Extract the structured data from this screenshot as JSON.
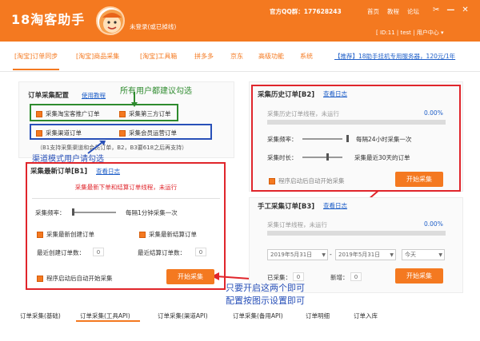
{
  "header": {
    "app_title": "18淘客助手",
    "login_status": "未登录(或已掉线)",
    "qq_group": "官方QQ群：177628243",
    "links": [
      "首页",
      "教程",
      "论坛"
    ],
    "user_bar": "[ ID:11 | test | 用户中心 ▾"
  },
  "nav": {
    "items": [
      "[淘宝]订单同步",
      "[淘宝]商品采集",
      "[淘宝]工具箱",
      "拼多多",
      "京东",
      "高级功能",
      "系统"
    ],
    "promo": "【推荐】18助手挂机专用服务器，120元/1年"
  },
  "config": {
    "title": "订单采集配置",
    "help": "使用教程",
    "options": [
      "采集淘宝客推广订单",
      "采集第三方订单",
      "采集渠道订单",
      "采集会员运营订单"
    ],
    "hint": "（B1支持采集渠道和会员订单，B2，B3要618之后再支持）",
    "note_green": "所有用户都建议勾选",
    "note_blue": "渠道模式用户请勾选"
  },
  "b1": {
    "title": "采集最新订单[B1]",
    "log": "查看日志",
    "status": "采集最新下单和结算订单线程，未运行",
    "freq_label": "采集频率：",
    "freq_value": "每隔1分钟采集一次",
    "opt_new": "采集最新创建订单",
    "opt_settle": "采集最新结算订单",
    "count_new_label": "最近创建订单数：",
    "count_new": "0",
    "count_settle_label": "最近结算订单数：",
    "count_settle": "0",
    "auto_start": "程序启动后自动开始采集",
    "start": "开始采集"
  },
  "b2": {
    "title": "采集历史订单[B2]",
    "log": "查看日志",
    "status": "采集历史订单线程，未运行",
    "freq_label": "采集频率：",
    "freq_value": "每隔24小时采集一次",
    "time_label": "采集时长：",
    "time_value": "采集最近30天的订单",
    "auto_start": "程序启动后自动开始采集",
    "start": "开始采集"
  },
  "b3": {
    "title": "手工采集订单[B3]",
    "log": "查看日志",
    "status": "采集订单线程，未运行",
    "percent": "0.00%",
    "date_from": "2019年5月31日",
    "date_to": "2019年5月31日",
    "date_range": "今天",
    "collected_label": "已采集：",
    "collected": "0",
    "added_label": "新增：",
    "added": "0",
    "start": "开始采集"
  },
  "b2_percent": "0.00%",
  "annotation_red": [
    "只要开启这两个即可",
    "配置按图示设置即可"
  ],
  "bottom_tabs": [
    "订单采集(基础)",
    "订单采集(工具API)",
    "订单采集(渠道API)",
    "订单采集(备用API)",
    "订单明细",
    "订单入库"
  ]
}
